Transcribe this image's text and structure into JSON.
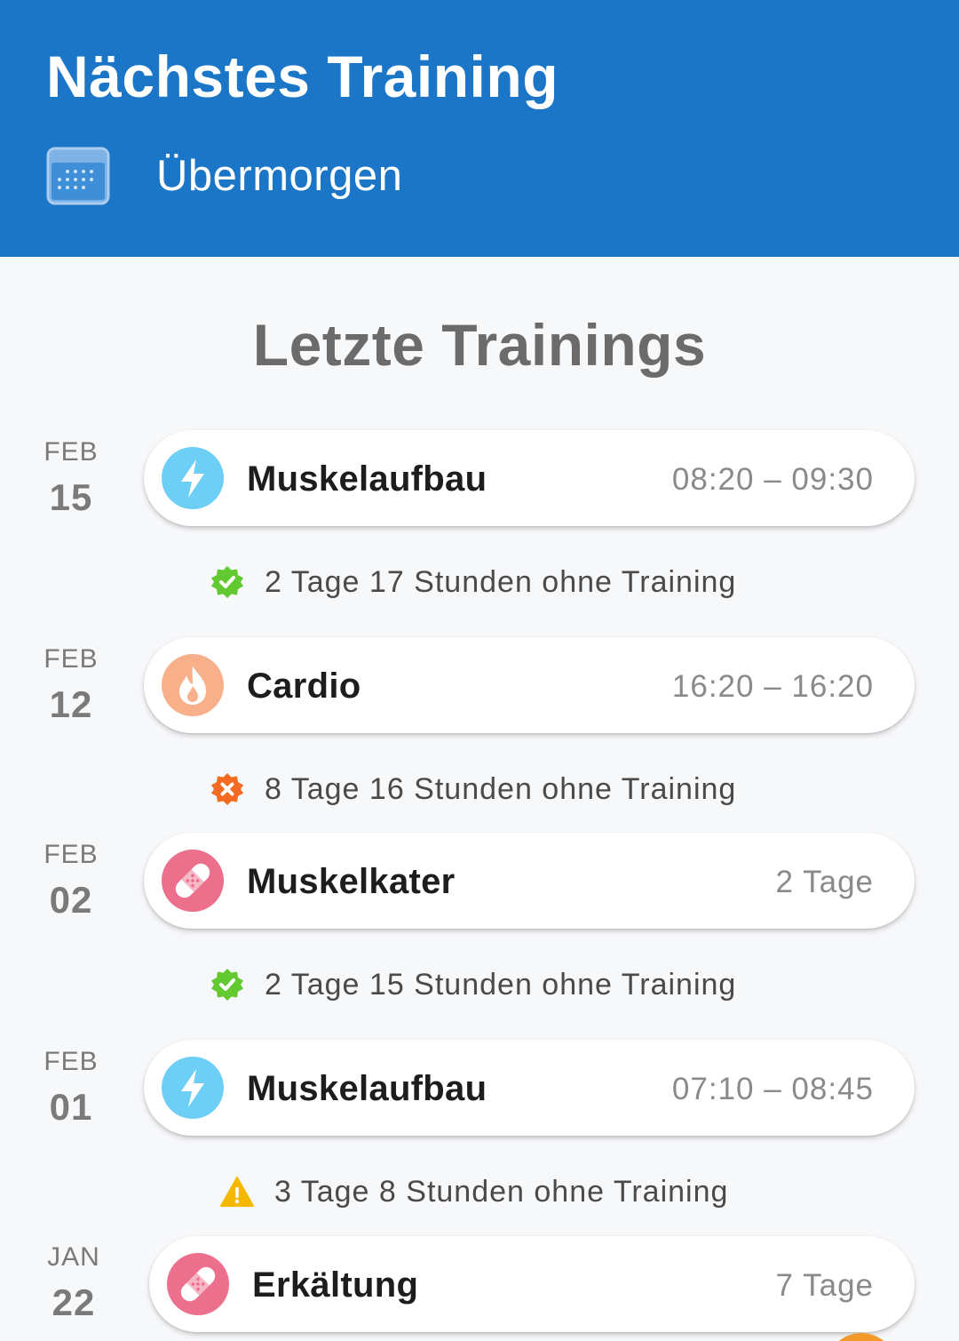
{
  "header": {
    "title": "Nächstes Training",
    "next_label": "Übermorgen",
    "icon": "calendar-icon",
    "color": "#1b76c8"
  },
  "section_title": "Letzte Trainings",
  "entries": [
    {
      "month": "FEB",
      "day": "15",
      "name": "Muskelaufbau",
      "detail": "08:20 – 09:30",
      "icon": "lightning-icon",
      "icon_color": "#6dcff6"
    },
    {
      "month": "FEB",
      "day": "12",
      "name": "Cardio",
      "detail": "16:20 – 16:20",
      "icon": "flame-icon",
      "icon_color": "#f7b08a"
    },
    {
      "month": "FEB",
      "day": "02",
      "name": "Muskelkater",
      "detail": "2 Tage",
      "icon": "bandage-icon",
      "icon_color": "#ec6f8c"
    },
    {
      "month": "FEB",
      "day": "01",
      "name": "Muskelaufbau",
      "detail": "07:10 – 08:45",
      "icon": "lightning-icon",
      "icon_color": "#6dcff6"
    },
    {
      "month": "JAN",
      "day": "22",
      "name": "Erkältung",
      "detail": "7 Tage",
      "icon": "bandage-icon",
      "icon_color": "#ec6f8c"
    }
  ],
  "gaps": [
    {
      "text": "2 Tage 17 Stunden ohne Training",
      "status": "ok",
      "icon": "check-badge-icon",
      "color": "#63c930"
    },
    {
      "text": "8 Tage 16 Stunden ohne Training",
      "status": "bad",
      "icon": "x-badge-icon",
      "color": "#f26b21"
    },
    {
      "text": "2 Tage 15 Stunden ohne Training",
      "status": "ok",
      "icon": "check-badge-icon",
      "color": "#63c930"
    },
    {
      "text": "3 Tage 8 Stunden ohne Training",
      "status": "warn",
      "icon": "warning-icon",
      "color": "#f5b800"
    }
  ]
}
